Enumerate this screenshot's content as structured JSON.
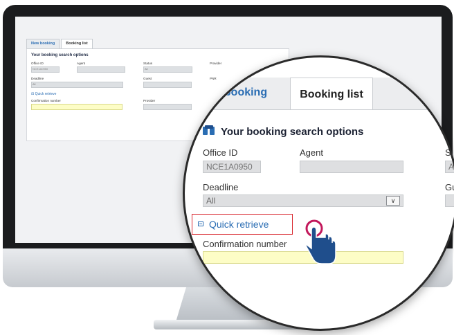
{
  "mini_screen": {
    "tabs": [
      {
        "label": "New booking",
        "active": false
      },
      {
        "label": "Booking list",
        "active": true
      }
    ],
    "title": "Your booking search options",
    "fields": {
      "office_id_label": "Office ID",
      "office_id_value": "NCE1A0950",
      "agent_label": "Agent",
      "status_label": "Status",
      "status_value": "All",
      "provider_label": "Provider",
      "deadline_label": "Deadline",
      "deadline_value": "All",
      "guest_label": "Guest",
      "pnr_label": "PNR",
      "quick_retrieve": "Quick retrieve",
      "confirmation_label": "Confirmation number",
      "provider2_label": "Provider"
    }
  },
  "zoom": {
    "tab_new": "w booking",
    "tab_list": "Booking list",
    "title": "Your booking search options",
    "office_id_label": "Office ID",
    "office_id_value": "NCE1A0950",
    "agent_label": "Agent",
    "deadline_label": "Deadline",
    "deadline_value": "All",
    "right_label_top": "S",
    "right_value_top": "A",
    "right_label_mid": "Gu",
    "quick_retrieve": "Quick retrieve",
    "confirmation_label": "Confirmation number"
  },
  "colors": {
    "accent_blue": "#2a6db3",
    "highlight_red": "#d9272e",
    "cursor_pink": "#c2185b",
    "hand_blue": "#1f4e8c",
    "yellow_field": "#fdfdc6"
  }
}
